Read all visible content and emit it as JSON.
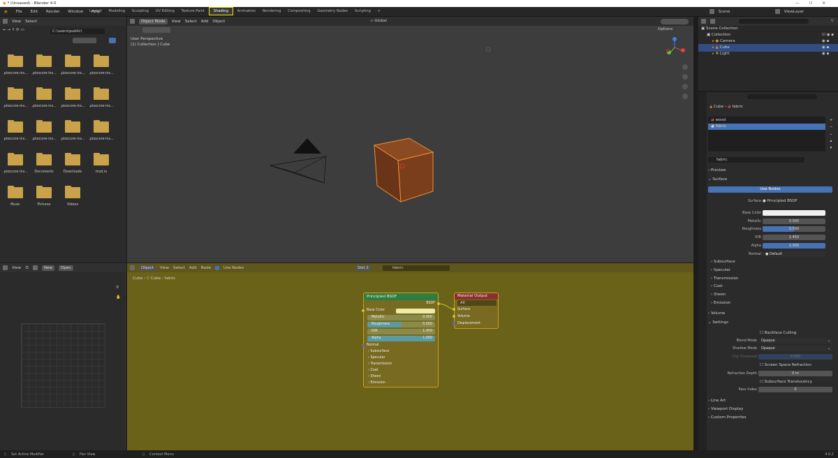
{
  "window": {
    "title": "* (Unsaved) - Blender 4.0"
  },
  "menu": [
    "File",
    "Edit",
    "Render",
    "Window",
    "Help"
  ],
  "workspace_tabs": [
    {
      "label": "Layout"
    },
    {
      "label": "Modeling"
    },
    {
      "label": "Sculpting"
    },
    {
      "label": "UV Editing"
    },
    {
      "label": "Texture Paint"
    },
    {
      "label": "Shading",
      "active": true
    },
    {
      "label": "Animation"
    },
    {
      "label": "Rendering"
    },
    {
      "label": "Compositing"
    },
    {
      "label": "Geometry Nodes"
    },
    {
      "label": "Scripting"
    },
    {
      "label": "+"
    }
  ],
  "scene": {
    "label": "Scene",
    "view_layer": "ViewLayer"
  },
  "file_browser": {
    "menu": [
      "View",
      "Select"
    ],
    "path": "C:\\users\\public\\",
    "items": [
      {
        "label": ".pioocore-ins..."
      },
      {
        "label": ".pioocore-ins..."
      },
      {
        "label": ".pioocore-ins..."
      },
      {
        "label": ".pioocore-ins..."
      },
      {
        "label": ".pioocore-ins..."
      },
      {
        "label": ".pioocore-ins..."
      },
      {
        "label": ".pioocore-ins..."
      },
      {
        "label": ".pioocore-ins..."
      },
      {
        "label": ".pioocore-ins..."
      },
      {
        "label": ".pioocore-ins..."
      },
      {
        "label": ".pioocore-ins..."
      },
      {
        "label": ".pioocore-ins..."
      },
      {
        "label": ".pioocore-ins..."
      },
      {
        "label": "Documents"
      },
      {
        "label": "Downloads"
      },
      {
        "label": "mod.io"
      },
      {
        "label": "Music"
      },
      {
        "label": "Pictures"
      },
      {
        "label": "Videos"
      }
    ]
  },
  "viewport": {
    "mode": "Object Mode",
    "menu": [
      "View",
      "Select",
      "Add",
      "Object"
    ],
    "orientation": "Global",
    "options": "Options",
    "overlay_line1": "User Perspective",
    "overlay_line2": "(1) Collection | Cube"
  },
  "image_editor": {
    "view": "View",
    "new": "New",
    "open": "Open"
  },
  "node_editor": {
    "object_menu": "Object",
    "menu": [
      "View",
      "Select",
      "Add",
      "Node"
    ],
    "use_nodes": "Use Nodes",
    "slot": "Slot 2",
    "material": "fabric",
    "breadcrumb": [
      "Cube",
      "Cube",
      "fabric"
    ],
    "principled": {
      "title": "Principled BSDF",
      "out": "BSDF",
      "base_color": "Base Color",
      "metallic": {
        "label": "Metallic",
        "value": "0.000"
      },
      "roughness": {
        "label": "Roughness",
        "value": "0.500"
      },
      "ior": {
        "label": "IOR",
        "value": "1.450"
      },
      "alpha": {
        "label": "Alpha",
        "value": "1.000"
      },
      "normal": "Normal",
      "panels": [
        "Subsurface",
        "Specular",
        "Transmission",
        "Coat",
        "Sheen",
        "Emission"
      ]
    },
    "output": {
      "title": "Material Output",
      "target": "All",
      "sockets": [
        "Surface",
        "Volume",
        "Displacement"
      ]
    }
  },
  "outliner": {
    "root": "Scene Collection",
    "items": [
      {
        "label": "Collection"
      },
      {
        "label": "Camera"
      },
      {
        "label": "Cube",
        "selected": true
      },
      {
        "label": "Light"
      }
    ]
  },
  "properties": {
    "breadcrumb": [
      "Cube",
      "fabric"
    ],
    "slots": [
      {
        "label": "wood"
      },
      {
        "label": "fabric",
        "selected": true
      }
    ],
    "material_name": "fabric",
    "panels_top": [
      "Preview",
      "Surface"
    ],
    "use_nodes": "Use Nodes",
    "surface": {
      "label": "Surface",
      "value": "Principled BSDF"
    },
    "fields": [
      {
        "label": "Base Color",
        "value": ""
      },
      {
        "label": "Metallic",
        "value": "0.000"
      },
      {
        "label": "Roughness",
        "value": "0.500"
      },
      {
        "label": "IOR",
        "value": "1.450"
      },
      {
        "label": "Alpha",
        "value": "1.000"
      },
      {
        "label": "Normal",
        "value": "Default"
      }
    ],
    "roughness_fraction": 0.5,
    "subpanels": [
      "Subsurface",
      "Specular",
      "Transmission",
      "Coat",
      "Sheen",
      "Emission"
    ],
    "volume": "Volume",
    "settings": "Settings",
    "backface": "Backface Culling",
    "blend_mode": {
      "label": "Blend Mode",
      "value": "Opaque"
    },
    "shadow_mode": {
      "label": "Shadow Mode",
      "value": "Opaque"
    },
    "clip": {
      "label": "Clip Threshold",
      "value": "0.500"
    },
    "ssr": "Screen Space Refraction",
    "refraction_depth": {
      "label": "Refraction Depth",
      "value": "0 m"
    },
    "sss_translucency": "Subsurface Translucency",
    "pass_index": {
      "label": "Pass Index",
      "value": "0"
    },
    "bottom_panels": [
      "Line Art",
      "Viewport Display",
      "Custom Properties"
    ]
  },
  "status": {
    "left": "Set Active Modifier",
    "middle": "Pan View",
    "right": "Context Menu",
    "version": "4.0.2"
  },
  "colors": {
    "accent": "#4772b3",
    "node_bg": "#786a20",
    "highlight": "#f5e50a"
  }
}
